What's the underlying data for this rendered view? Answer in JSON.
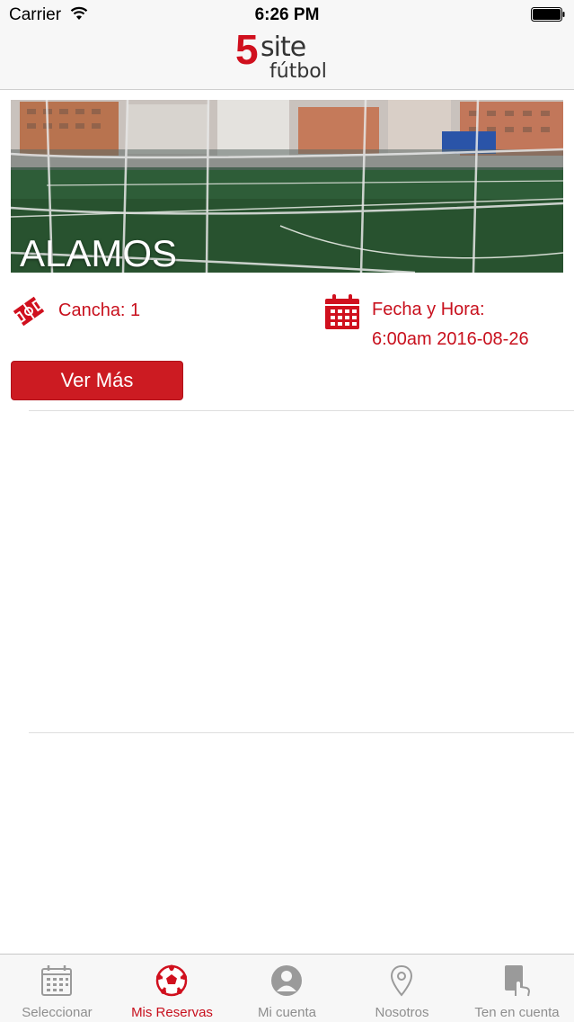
{
  "status_bar": {
    "carrier": "Carrier",
    "time": "6:26 PM"
  },
  "brand": {
    "logo_number": "5",
    "logo_word": "site",
    "logo_sub": "fútbol",
    "accent_color": "#d0101e"
  },
  "reservation": {
    "venue_name": "ALAMOS",
    "cancha_label": "Cancha: 1",
    "fecha_label": "Fecha y Hora:",
    "fecha_value": "6:00am 2016-08-26",
    "button_label": "Ver Más"
  },
  "tabs": [
    {
      "label": "Seleccionar",
      "icon": "calendar-icon",
      "active": false
    },
    {
      "label": "Mis Reservas",
      "icon": "soccer-ball-icon",
      "active": true
    },
    {
      "label": "Mi cuenta",
      "icon": "user-icon",
      "active": false
    },
    {
      "label": "Nosotros",
      "icon": "location-pin-icon",
      "active": false
    },
    {
      "label": "Ten en cuenta",
      "icon": "hand-card-icon",
      "active": false
    }
  ]
}
